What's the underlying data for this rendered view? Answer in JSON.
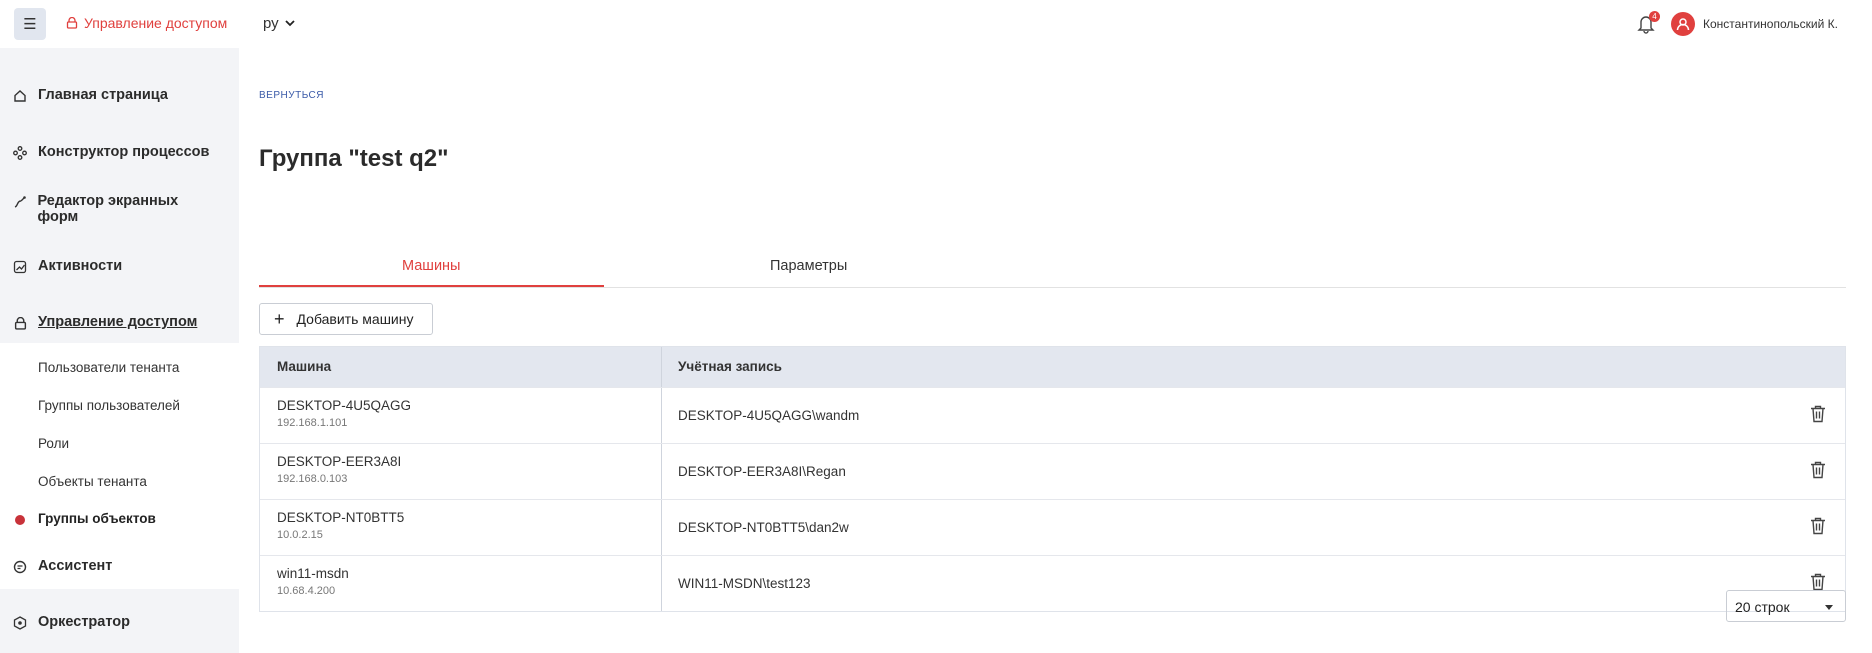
{
  "header": {
    "menu_icon": "hamburger-icon",
    "app_title": "Управление доступом",
    "lang": "ру",
    "notifications_count": "4",
    "username": "Константинопольский К."
  },
  "sidebar": {
    "items": [
      {
        "label": "Главная страница",
        "icon": "home-icon"
      },
      {
        "label": "Конструктор процессов",
        "icon": "process-icon"
      },
      {
        "label": "Редактор экранных форм",
        "icon": "forms-icon"
      },
      {
        "label": "Активности",
        "icon": "activity-icon"
      },
      {
        "label": "Управление доступом",
        "icon": "access-icon"
      },
      {
        "label": "Ассистент",
        "icon": "assistant-icon"
      },
      {
        "label": "Оркестратор",
        "icon": "orchestrator-icon"
      }
    ],
    "sub_items": [
      {
        "label": "Пользователи тенанта"
      },
      {
        "label": "Группы пользователей"
      },
      {
        "label": "Роли"
      },
      {
        "label": "Объекты тенанта"
      },
      {
        "label": "Группы объектов"
      }
    ]
  },
  "main": {
    "back": "ВЕРНУТЬСЯ",
    "title": "Группа \"test q2\"",
    "tabs": [
      {
        "label": "Машины"
      },
      {
        "label": "Параметры"
      }
    ],
    "add_button": "Добавить машину",
    "table": {
      "columns": [
        "Машина",
        "Учётная запись"
      ],
      "rows": [
        {
          "machine": "DESKTOP-4U5QAGG",
          "ip": "192.168.1.101",
          "account": "DESKTOP-4U5QAGG\\wandm"
        },
        {
          "machine": "DESKTOP-EER3A8I",
          "ip": "192.168.0.103",
          "account": "DESKTOP-EER3A8I\\Regan"
        },
        {
          "machine": "DESKTOP-NT0BTT5",
          "ip": "10.0.2.15",
          "account": "DESKTOP-NT0BTT5\\dan2w"
        },
        {
          "machine": "win11-msdn",
          "ip": "10.68.4.200",
          "account": "WIN11-MSDN\\test123"
        }
      ]
    },
    "rows_per_page": "20 строк"
  },
  "colors": {
    "accent": "#e0403e",
    "header_bg": "#e3e7ef",
    "sidebar_bg": "#f3f4f7"
  }
}
